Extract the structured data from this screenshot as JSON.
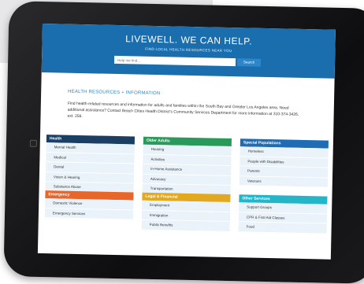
{
  "hero": {
    "title": "LIVEWELL. WE CAN HELP.",
    "subtitle": "FIND LOCAL HEALTH RESOURCES NEAR YOU",
    "search_placeholder": "Help me find...",
    "search_button": "Search"
  },
  "section": {
    "heading": "HEALTH RESOURCES + INFORMATION",
    "intro": "Find health-related resources and information for adults and families within the South Bay and Greater Los Angeles area. Need additional assistance? Contact Beach Cities Health District's Community Services Department for more information at 310-374-3426, ext. 256."
  },
  "categories": [
    {
      "title": "Health",
      "color": "#1a3f63",
      "items": [
        "Mental Health",
        "Medical",
        "Dental",
        "Vision & Hearing",
        "Substance Abuse"
      ]
    },
    {
      "title": "Older Adults",
      "color": "#2a9a5a",
      "items": [
        "Housing",
        "Activities",
        "In-Home Assistance",
        "Advocacy",
        "Transportation"
      ]
    },
    {
      "title": "Special Populations",
      "color": "#1e6cb4",
      "items": [
        "Homeless",
        "People with Disabilities",
        "Parents",
        "Veterans"
      ]
    },
    {
      "title": "Emergency",
      "color": "#e8662a",
      "items": [
        "Domestic Violence",
        "Emergency Services"
      ]
    },
    {
      "title": "Legal & Financial",
      "color": "#e2a81f",
      "items": [
        "Employment",
        "Immigration",
        "Public Benefits"
      ]
    },
    {
      "title": "Other Services",
      "color": "#24b5c9",
      "items": [
        "Support Groups",
        "CPR & First Aid Classes",
        "Food"
      ]
    }
  ]
}
